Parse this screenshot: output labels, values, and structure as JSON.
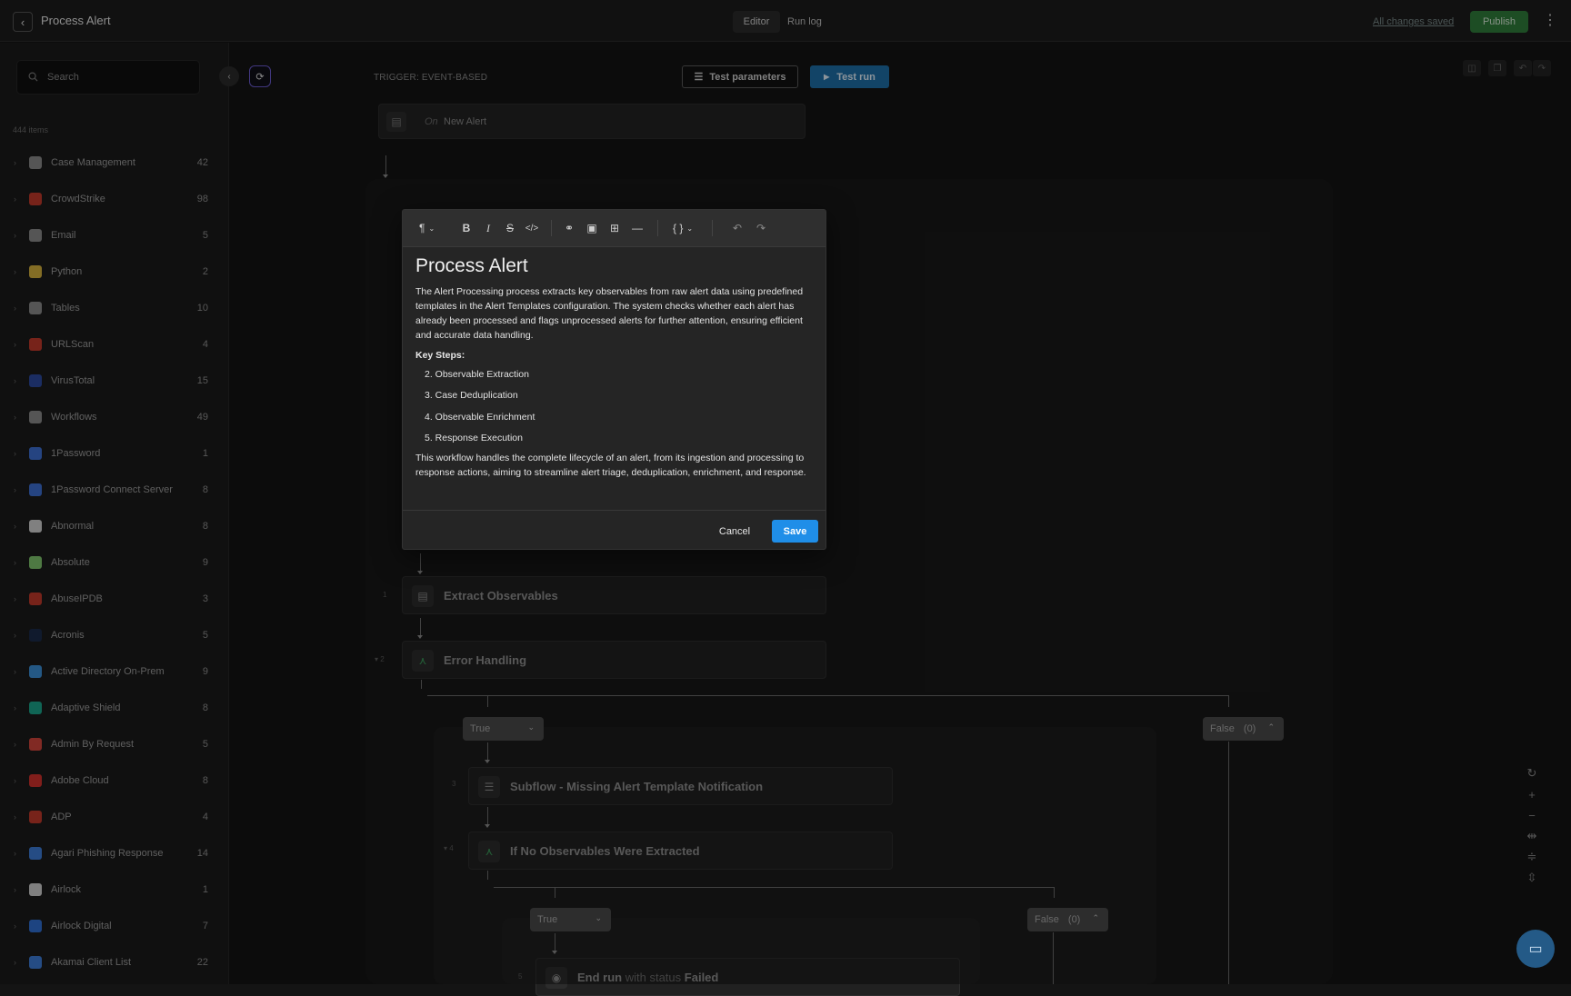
{
  "header": {
    "title": "Process Alert",
    "tabs": [
      {
        "label": "Editor"
      },
      {
        "label": "Run log"
      }
    ],
    "saved_status": "All changes saved",
    "publish_label": "Publish"
  },
  "sidebar": {
    "search_placeholder": "Search",
    "items_count": "444 items",
    "categories": [
      {
        "label": "Case Management",
        "count": "42",
        "color": "#8a8a8a"
      },
      {
        "label": "CrowdStrike",
        "count": "98",
        "color": "#c0392b"
      },
      {
        "label": "Email",
        "count": "5",
        "color": "#8a8a8a"
      },
      {
        "label": "Python",
        "count": "2",
        "color": "#d4b13c"
      },
      {
        "label": "Tables",
        "count": "10",
        "color": "#8a8a8a"
      },
      {
        "label": "URLScan",
        "count": "4",
        "color": "#c0392b"
      },
      {
        "label": "VirusTotal",
        "count": "15",
        "color": "#2c4a9e"
      },
      {
        "label": "Workflows",
        "count": "49",
        "color": "#8a8a8a"
      },
      {
        "label": "1Password",
        "count": "1",
        "color": "#3c6fd1"
      },
      {
        "label": "1Password Connect Server",
        "count": "8",
        "color": "#3c6fd1"
      },
      {
        "label": "Abnormal",
        "count": "8",
        "color": "#cfcfcf"
      },
      {
        "label": "Absolute",
        "count": "9",
        "color": "#7ec46c"
      },
      {
        "label": "AbuseIPDB",
        "count": "3",
        "color": "#c0392b"
      },
      {
        "label": "Acronis",
        "count": "5",
        "color": "#1b2a4a"
      },
      {
        "label": "Active Directory On-Prem",
        "count": "9",
        "color": "#3a8fd6"
      },
      {
        "label": "Adaptive Shield",
        "count": "8",
        "color": "#1aa38a"
      },
      {
        "label": "Admin By Request",
        "count": "5",
        "color": "#d0443a"
      },
      {
        "label": "Adobe Cloud",
        "count": "8",
        "color": "#d0312d"
      },
      {
        "label": "ADP",
        "count": "4",
        "color": "#c0392b"
      },
      {
        "label": "Agari Phishing Response",
        "count": "14",
        "color": "#3c7bd6"
      },
      {
        "label": "Airlock",
        "count": "1",
        "color": "#cfcfcf"
      },
      {
        "label": "Airlock Digital",
        "count": "7",
        "color": "#2f6fd1"
      },
      {
        "label": "Akamai Client List",
        "count": "22",
        "color": "#3c7bd6"
      }
    ]
  },
  "canvas": {
    "trigger_label": "TRIGGER: EVENT-BASED",
    "test_params_label": "Test parameters",
    "test_run_label": "Test run",
    "trigger_node": {
      "prefix": "On",
      "name": "New Alert"
    },
    "nodes": [
      {
        "step": "1",
        "label": "Extract Observables"
      },
      {
        "step": "2",
        "label": "Error Handling"
      },
      {
        "step": "3",
        "label": "Subflow - Missing Alert Template Notification"
      },
      {
        "step": "4",
        "label": "If No Observables Were Extracted"
      },
      {
        "step": "5",
        "label_prefix": "End run",
        "label_mid": "with status",
        "label_status": "Failed"
      }
    ],
    "branches": {
      "true_label": "True",
      "false_label": "False",
      "false_count": "(0)"
    }
  },
  "modal": {
    "title": "Process Alert",
    "paragraph1": "The Alert Processing process extracts key observables from raw alert data using predefined templates in the Alert Templates configuration. The system checks whether each alert has already been processed and flags unprocessed alerts for further attention, ensuring efficient and accurate data handling.",
    "key_steps_label": "Key Steps:",
    "steps": [
      "2. Observable Extraction",
      "3. Case Deduplication",
      "4. Observable Enrichment",
      "5. Response Execution"
    ],
    "paragraph2": "This workflow handles the complete lifecycle of an alert, from its ingestion and processing to response actions, aiming to streamline alert triage, deduplication, enrichment, and response.",
    "cancel_label": "Cancel",
    "save_label": "Save"
  },
  "colors": {
    "accent_blue": "#1f8ee8",
    "publish_green": "#2f7d3a",
    "test_run_blue": "#1d6ea6"
  }
}
